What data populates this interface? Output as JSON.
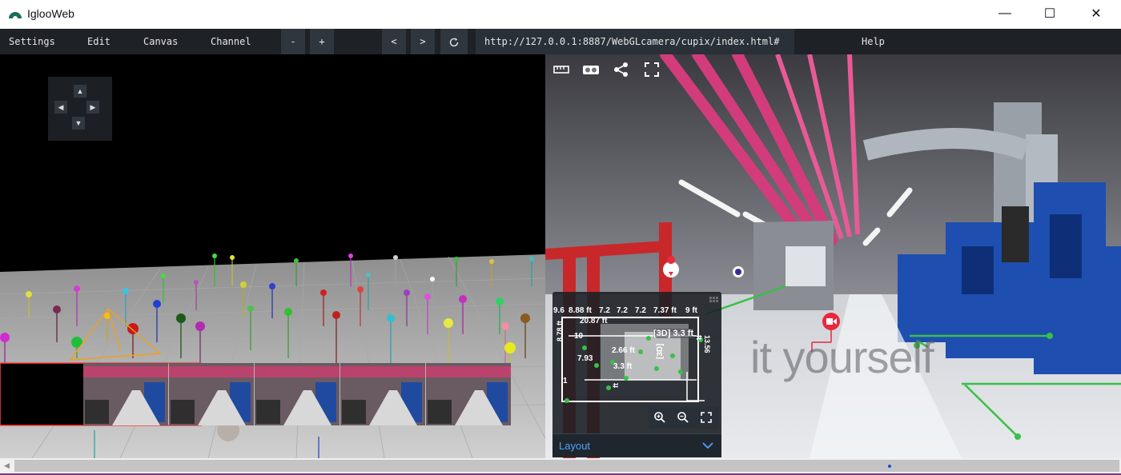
{
  "window": {
    "title": "IglooWeb",
    "minimize_glyph": "—",
    "maximize_glyph": "☐",
    "close_glyph": "✕"
  },
  "menu": {
    "settings": "Settings",
    "edit": "Edit",
    "canvas": "Canvas",
    "channel": "Channel",
    "zoom_out": "-",
    "zoom_in": "+",
    "back": "<",
    "forward": ">",
    "url": "http://127.0.0.1:8887/WebGLcamera/cupix/index.html#",
    "help": "Help"
  },
  "left_view": {
    "nav_up": "▲",
    "nav_left": "◀",
    "nav_right": "▶",
    "nav_down": "▼"
  },
  "right_view": {
    "watermark": "it yourself",
    "layout_label": "Layout",
    "measurements": [
      "9.6",
      "8.88 ft",
      "7.2",
      "7.2",
      "7.2",
      "7.37 ft",
      "9 ft",
      "20.87 ft",
      "10",
      "8.78 ft",
      "7.93",
      "2.66 ft",
      "[3D] 3.3 ft",
      "3.3 ft",
      "[3D]",
      "13.56 ft",
      "10",
      "3",
      "1",
      "ft"
    ]
  },
  "colors": {
    "menubar_bg": "#1e2227",
    "accent_blue": "#4aa3ff",
    "scroll_dot": "#1f4fd0"
  }
}
